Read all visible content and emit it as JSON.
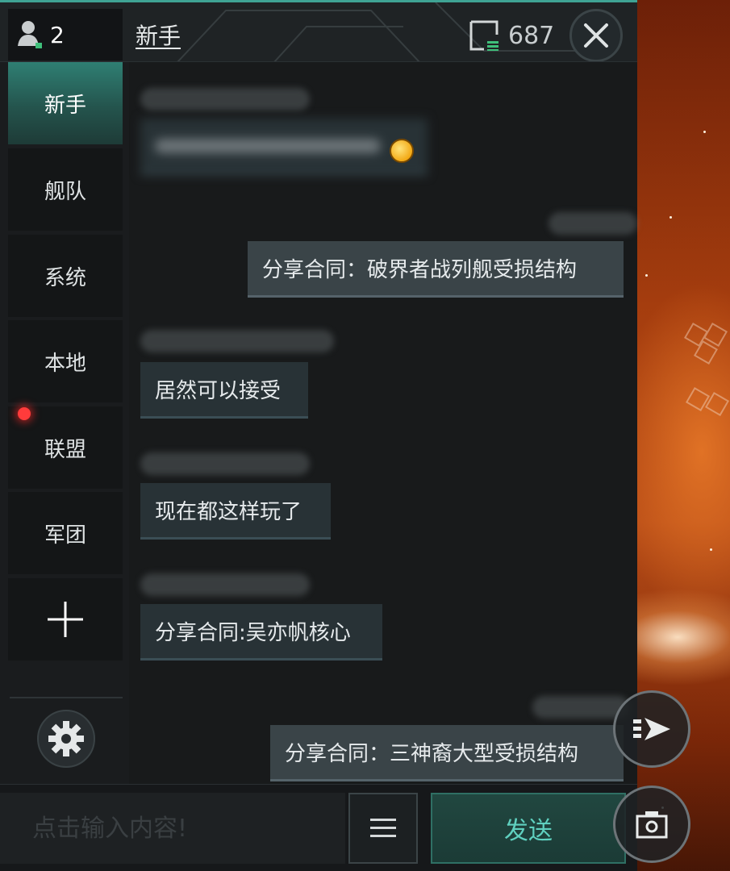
{
  "header": {
    "online_count": "2",
    "channel_title": "新手",
    "message_count": "687"
  },
  "sidebar": {
    "tabs": [
      {
        "label": "新手",
        "active": true
      },
      {
        "label": "舰队",
        "active": false
      },
      {
        "label": "系统",
        "active": false
      },
      {
        "label": "本地",
        "active": false
      },
      {
        "label": "联盟",
        "active": false,
        "unread": true
      },
      {
        "label": "军团",
        "active": false
      }
    ],
    "add_icon": "plus-icon",
    "settings_icon": "gear-icon"
  },
  "messages": [
    {
      "side": "left",
      "sender_visible": false,
      "text": "",
      "blurred": true,
      "emoji": "smiley-emoji"
    },
    {
      "side": "right",
      "sender_visible": false,
      "text": "分享合同：破界者战列舰受损结构"
    },
    {
      "side": "left",
      "sender_visible": false,
      "text": "居然可以接受"
    },
    {
      "side": "left",
      "sender_visible": false,
      "text": "现在都这样玩了"
    },
    {
      "side": "left",
      "sender_visible": false,
      "text": "分享合同:吴亦帆核心"
    },
    {
      "side": "right",
      "sender_visible": false,
      "text": "分享合同：三神裔大型受损结构"
    }
  ],
  "input": {
    "placeholder": "点击输入内容!",
    "menu_icon": "menu-icon",
    "send_label": "发送"
  },
  "colors": {
    "accent": "#3fa394",
    "send_text": "#5fd0bf",
    "unread_dot": "#ff3b3b",
    "bubble": "#283236",
    "bubble_right": "#3a4448"
  },
  "side_buttons": [
    "autopilot-icon",
    "camera-icon"
  ]
}
